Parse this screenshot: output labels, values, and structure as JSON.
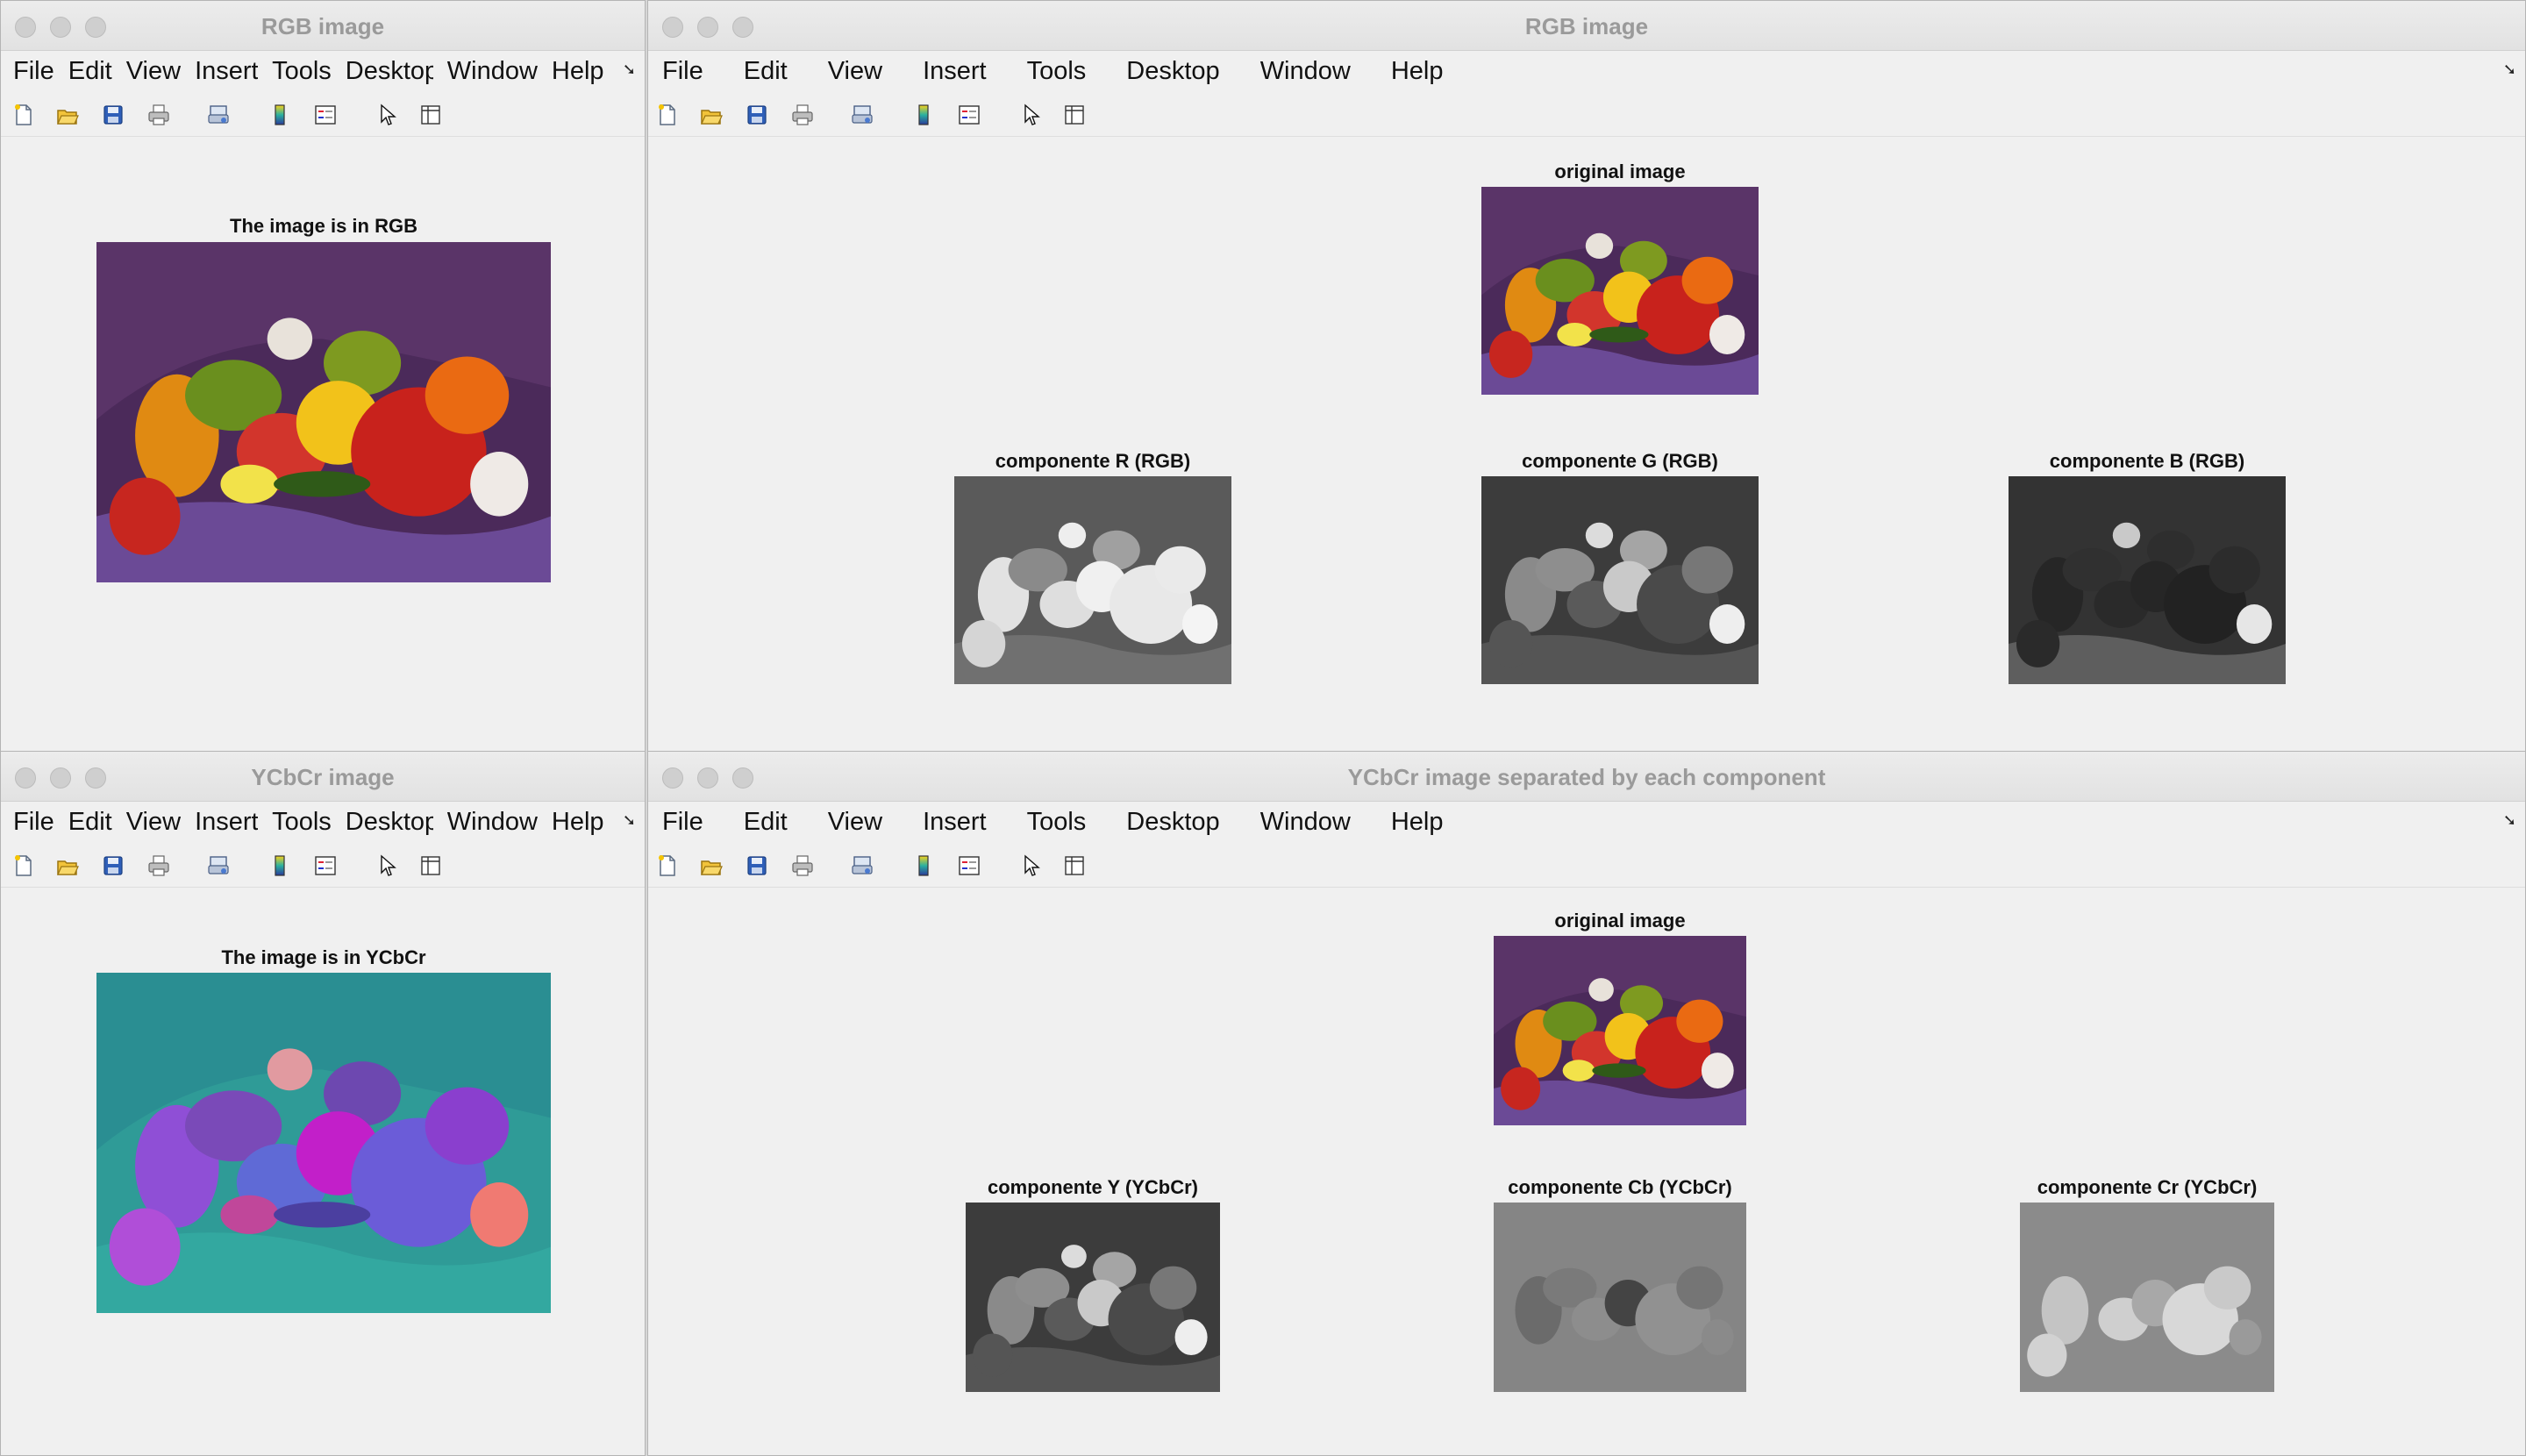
{
  "menus": [
    "File",
    "Edit",
    "View",
    "Insert",
    "Tools",
    "Desktop",
    "Window",
    "Help"
  ],
  "menus_narrow": [
    "File",
    "Edit",
    "View",
    "Insert",
    "Tools",
    "Desktop",
    "Window",
    "Help"
  ],
  "toolbar_icons": [
    "new-file-icon",
    "open-folder-icon",
    "save-icon",
    "print-icon",
    "print-preview-icon",
    "colorbar-icon",
    "legend-icon",
    "pointer-icon",
    "property-editor-icon"
  ],
  "windows": {
    "tl": {
      "title": "RGB image",
      "axis_title": "The image is in RGB"
    },
    "tr": {
      "title": "RGB image",
      "original_title": "original image",
      "comp1": "componente R (RGB)",
      "comp2": "componente G (RGB)",
      "comp3": "componente B (RGB)"
    },
    "bl": {
      "title": "YCbCr image",
      "axis_title": "The image is in YCbCr"
    },
    "br": {
      "title": "YCbCr image separated by each component",
      "original_title": "original image",
      "comp1": "componente Y (YCbCr)",
      "comp2": "componente Cb (YCbCr)",
      "comp3": "componente Cr (YCbCr)"
    }
  },
  "colors": {
    "window_bg": "#f0f0f0",
    "title_text": "#9a9a9a"
  }
}
